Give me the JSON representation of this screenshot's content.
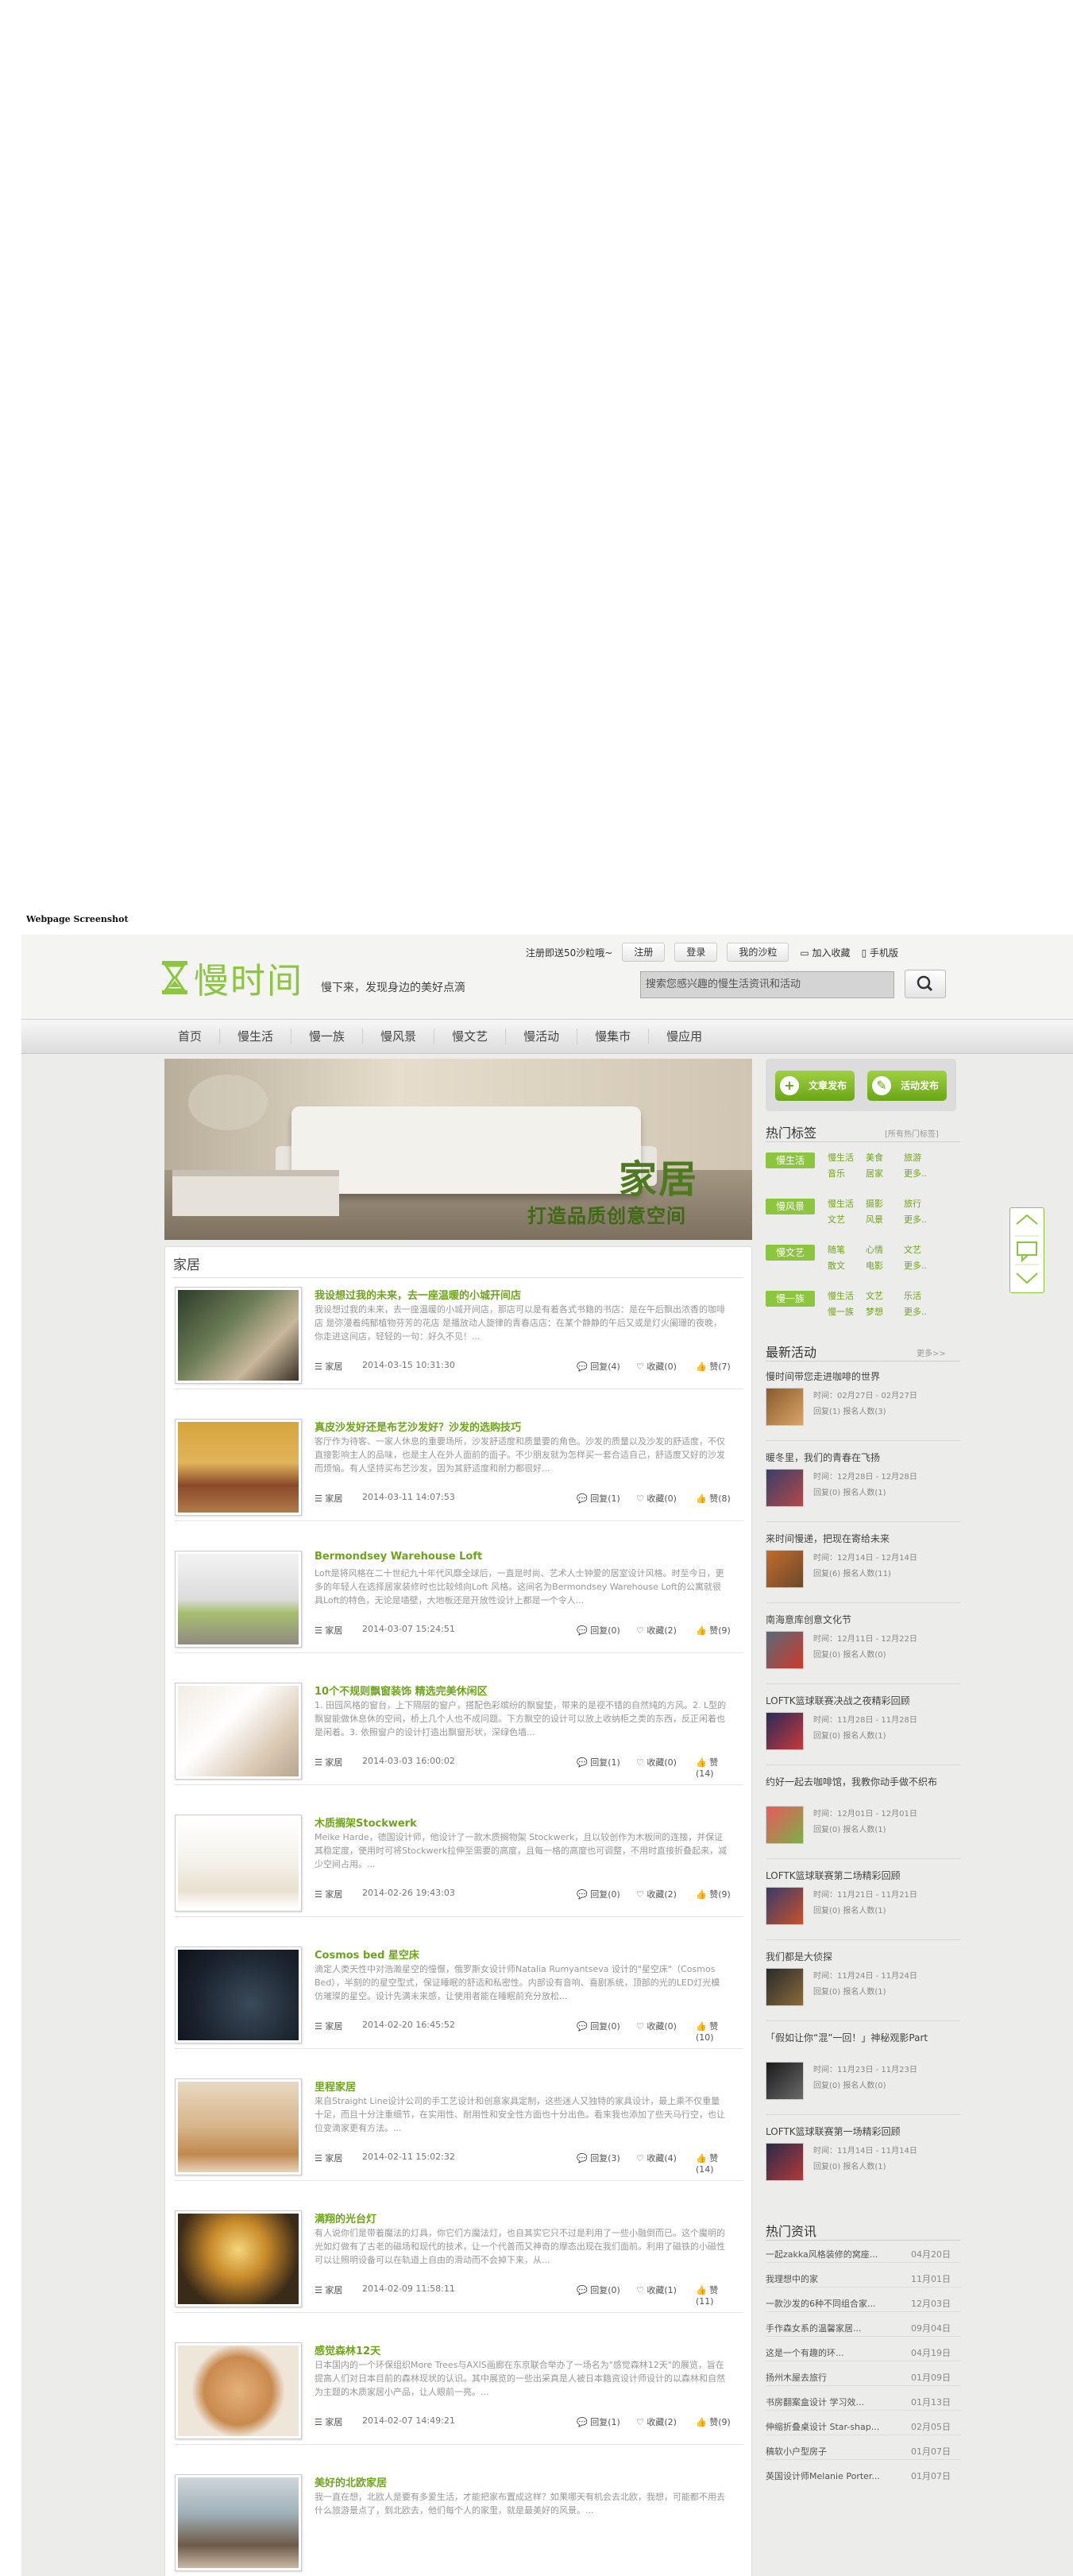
{
  "caption": "Webpage Screenshot",
  "header": {
    "logo_text": "慢时间",
    "slogan": "慢下来，发现身边的美好点滴",
    "notice": "注册即送50沙粒哦~",
    "register": "注册",
    "login": "登录",
    "my_sand": "我的沙粒",
    "favorite": "加入收藏",
    "mobile": "手机版",
    "search_placeholder": "搜索您感兴趣的慢生活资讯和活动"
  },
  "nav": [
    "首页",
    "慢生活",
    "慢一族",
    "慢风景",
    "慢文艺",
    "慢活动",
    "慢集市",
    "慢应用"
  ],
  "banner": {
    "title": "家居",
    "subtitle": "打造品质创意空间"
  },
  "main": {
    "section_title": "家居",
    "articles": [
      {
        "title": "我设想过我的未来，去一座温暖的小城开间店",
        "summary": "我设想过我的未来，去一座温暖的小城开间店，那店可以是有着各式书籍的书店：是在午后飘出浓香的咖啡店 是弥漫着纯郁植物芬芳的花店 是播放动人旋律的青春店店：在某个静静的午后又或是灯火阑珊的夜晚，你走进这间店，轻轻的一句：好久不见！...",
        "category": "家居",
        "date": "2014-03-15 10:31:30",
        "reply": "回复(4)",
        "fav": "收藏(0)",
        "like": "赞(7)"
      },
      {
        "title": "真皮沙发好还是布艺沙发好？沙发的选购技巧",
        "summary": "客厅作为待客、一家人休息的重要场所，沙发舒适度和质量要的角色。沙发的质量以及沙发的舒适度，不仅直接影响主人的品味，也是主人在外人面前的面子。不少朋友就为怎样买一套合适自己，舒适度又好的沙发而烦恼。有人坚持买布艺沙发，因为其舒适度和耐力都很好...",
        "category": "家居",
        "date": "2014-03-11 14:07:53",
        "reply": "回复(1)",
        "fav": "收藏(0)",
        "like": "赞(8)"
      },
      {
        "title": "Bermondsey Warehouse Loft",
        "summary": "Loft是将风格在二十世纪九十年代风靡全球后，一直是时尚、艺术人士钟爱的居室设计风格。时至今日，更多的年轻人在选择居家装修时也比较倾向Loft 风格。这间名为Bermondsey Warehouse Loft的公寓就很具Loft的特色，无论是墙壁，大地板还是开放性设计上都是一个令人...",
        "category": "家居",
        "date": "2014-03-07 15:24:51",
        "reply": "回复(0)",
        "fav": "收藏(2)",
        "like": "赞(9)"
      },
      {
        "title": "10个不规则飘窗装饰 精选完美休闲区",
        "summary": "1. 田园风格的窗台，上下隔层的窗户，搭配色彩缤纷的飘窗垫，带来的是视不错的自然纯的方风。2. L型的飘窗能做休息休的空间，桥上几个人也不成问题。下方飘空的设计可以放上收纳柜之类的东西，反正闲着也是闲着。3. 依照窗户的设计打造出飘窗形状，深绿色墙...",
        "category": "家居",
        "date": "2014-03-03 16:00:02",
        "reply": "回复(1)",
        "fav": "收藏(0)",
        "like": "赞(14)"
      },
      {
        "title": "木质搁架Stockwerk",
        "summary": "Meike Harde，德国设计师，他设计了一款木质搁物架 Stockwerk，且以较创作为木板间的连接，并保证其稳定度，使用时可将Stockwerk拉伸至需要的高度，且每一格的高度也可调整，不用时直接折叠起来，减少空间占用。...",
        "category": "家居",
        "date": "2014-02-26 19:43:03",
        "reply": "回复(0)",
        "fav": "收藏(2)",
        "like": "赞(9)"
      },
      {
        "title": "Cosmos bed 星空床",
        "summary": "滴定人类天性中对浩瀚星空的憧憬，俄罗斯女设计师Natalia Rumyantseva 设计的\"星空床\"（Cosmos Bed），半刻的的星空型式，保证睡眠的舒适和私密性。内部设有音响、喜剧系统，顶部的光的LED灯光模仿璀璨的星空。设计先满未来感，让使用者能在睡眠前充分放松...",
        "category": "家居",
        "date": "2014-02-20 16:45:52",
        "reply": "回复(0)",
        "fav": "收藏(0)",
        "like": "赞(10)"
      },
      {
        "title": "里程家居",
        "summary": "来自Straight Line设计公司的手工艺设计和创意家具定制，这些迷人又独特的家具设计，最上乘不仅重量十足，而且十分注重细节，在实用性、耐用性和安全性方面也十分出色。看来我也添加了些天马行空，也让位变滴家更有方法。...",
        "category": "家居",
        "date": "2014-02-11 15:02:32",
        "reply": "回复(3)",
        "fav": "收藏(4)",
        "like": "赞(14)"
      },
      {
        "title": "满翔的光台灯",
        "summary": "有人说你们是带着魔法的灯具，你它们方魔法灯，也自其实它只不过是利用了一些小融倒而已。这个魔明的光如灯做有了古老的磁场和现代的技术，让一个代善而又神奇的摩态出现在我们面前。利用了磁铁的小磁性可以让照明设备可以在轨道上自由的滑动而不会掉下来，从...",
        "category": "家居",
        "date": "2014-02-09 11:58:11",
        "reply": "回复(0)",
        "fav": "收藏(1)",
        "like": "赞(11)"
      },
      {
        "title": "感觉森林12天",
        "summary": "日本国内的一个环保组织More Trees与AXIS画廊在东京联合举办了一场名为\"感觉森林12天\"的展览，旨在提高人们对日本目前的森林现状的认识。其中展览的一些出采真是人被日本籍资设计师设计的以森林和自然为主题的木质家居小产品，让人眼前一亮。...",
        "category": "家居",
        "date": "2014-02-07 14:49:21",
        "reply": "回复(1)",
        "fav": "收藏(2)",
        "like": "赞(9)"
      },
      {
        "title": "美好的北欧家居",
        "summary": "我一直在想，北欧人是要有多爱生活，才能把家布置成这样？如果哪天有机会去北欧，我想，可能都不用去什么旅游景点了，到北欧去，他们每个人的家里，就是最美好的风景。...",
        "category": "家居",
        "date": "",
        "reply": "",
        "fav": "",
        "like": ""
      }
    ]
  },
  "sidebar": {
    "publish_article": "文章发布",
    "publish_activity": "活动发布",
    "hot_tags_title": "热门标签",
    "hot_tags_more": "[所有热门标签]",
    "tag_groups": [
      {
        "label": "慢生活",
        "tags": [
          "慢生活",
          "美食",
          "旅游",
          "音乐",
          "居家",
          "更多.."
        ]
      },
      {
        "label": "慢风景",
        "tags": [
          "慢生活",
          "摄影",
          "旅行",
          "文艺",
          "风景",
          "更多.."
        ]
      },
      {
        "label": "慢文艺",
        "tags": [
          "随笔",
          "心情",
          "文艺",
          "散文",
          "电影",
          "更多.."
        ]
      },
      {
        "label": "慢一族",
        "tags": [
          "慢生活",
          "文艺",
          "乐活",
          "慢一族",
          "梦想",
          "更多.."
        ]
      }
    ],
    "latest_title": "最新活动",
    "latest_more": "更多>>",
    "activities": [
      {
        "title": "慢时间带您走进咖啡的世界",
        "time": "时间：02月27日 - 02月27日",
        "stats": "回复(1) 报名人数(3)"
      },
      {
        "title": "暖冬里，我们的青春在飞扬",
        "time": "时间：12月28日 - 12月28日",
        "stats": "回复(0) 报名人数(1)"
      },
      {
        "title": "来时间慢递，把现在寄给未来",
        "time": "时间：12月14日 - 12月14日",
        "stats": "回复(6) 报名人数(11)"
      },
      {
        "title": "南海意库创意文化节",
        "time": "时间：12月11日 - 12月22日",
        "stats": "回复(0) 报名人数(0)"
      },
      {
        "title": "LOFTK篮球联赛决战之夜精彩回顾",
        "time": "时间：11月28日 - 11月28日",
        "stats": "回复(0) 报名人数(1)"
      },
      {
        "title": "约好一起去咖啡馆，我教你动手做不织布",
        "time": "时间：12月01日 - 12月01日",
        "stats": "回复(0) 报名人数(1)"
      },
      {
        "title": "LOFTK篮球联赛第二场精彩回顾",
        "time": "时间：11月21日 - 11月21日",
        "stats": "回复(0) 报名人数(1)"
      },
      {
        "title": "我们都是大侦探",
        "time": "时间：11月24日 - 11月24日",
        "stats": "回复(0) 报名人数(1)"
      },
      {
        "title": "「假如让你“混”一回！」神秘观影Part",
        "time": "时间：11月23日 - 11月23日",
        "stats": "回复(0) 报名人数(0)"
      },
      {
        "title": "LOFTK篮球联赛第一场精彩回顾",
        "time": "时间：11月14日 - 11月14日",
        "stats": "回复(0) 报名人数(1)"
      }
    ],
    "hot_news_title": "热门资讯",
    "news": [
      {
        "t": "一起zakka风格装修的窝座...",
        "d": "04月20日"
      },
      {
        "t": "我理想中的家",
        "d": "11月01日"
      },
      {
        "t": "一款沙发的6种不同组合家...",
        "d": "12月03日"
      },
      {
        "t": "手作森女系的温馨家居...",
        "d": "09月04日"
      },
      {
        "t": "这是一个有趣的环...",
        "d": "04月19日"
      },
      {
        "t": "扬州木屋去旅行",
        "d": "01月09日"
      },
      {
        "t": "书房翻案盒设计 学习效...",
        "d": "01月13日"
      },
      {
        "t": "伸缩折叠桌设计 Star-shap...",
        "d": "02月05日"
      },
      {
        "t": "稿软小户型房子",
        "d": "01月07日"
      },
      {
        "t": "英国设计师Melanie Porter...",
        "d": "01月07日"
      }
    ]
  }
}
